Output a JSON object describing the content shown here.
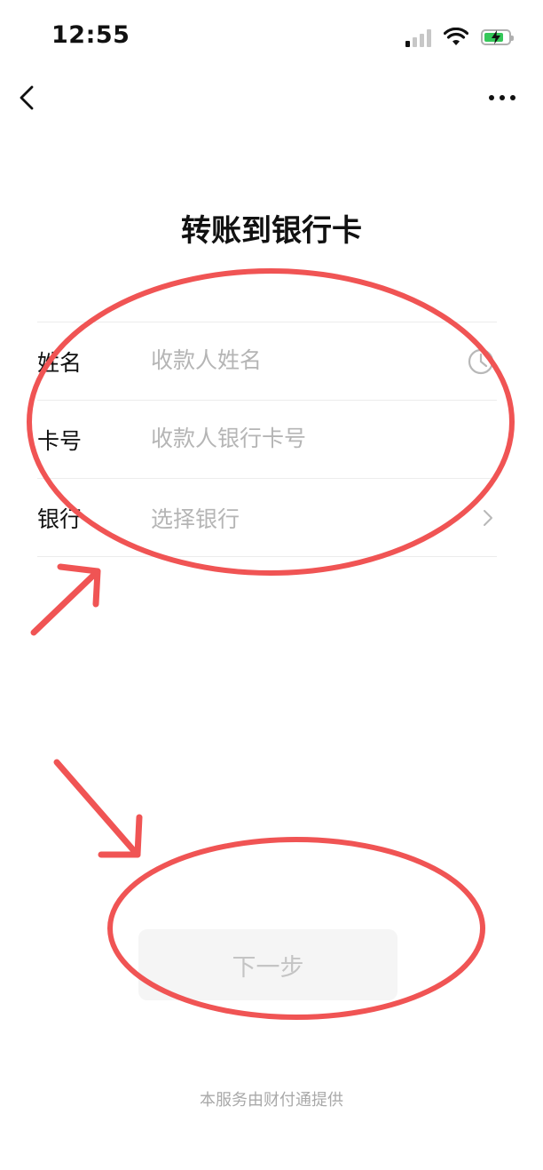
{
  "status_bar": {
    "time": "12:55",
    "battery_color": "#35c759",
    "battery_level": 0.8,
    "icons": [
      "signal-icon",
      "wifi-icon",
      "battery-charging-icon"
    ]
  },
  "nav": {
    "back_icon": "chevron-left-icon",
    "more_icon": "more-horizontal-icon"
  },
  "page": {
    "title": "转账到银行卡"
  },
  "form": {
    "name": {
      "label": "姓名",
      "placeholder": "收款人姓名",
      "icon": "clock-icon"
    },
    "card": {
      "label": "卡号",
      "placeholder": "收款人银行卡号"
    },
    "bank": {
      "label": "银行",
      "placeholder": "选择银行",
      "icon": "chevron-right-icon"
    }
  },
  "actions": {
    "next_label": "下一步"
  },
  "footer": {
    "text": "本服务由财付通提供"
  },
  "colors": {
    "annotation_red": "#f05454",
    "placeholder": "#b5b5b5",
    "button_bg": "#f5f5f5"
  }
}
